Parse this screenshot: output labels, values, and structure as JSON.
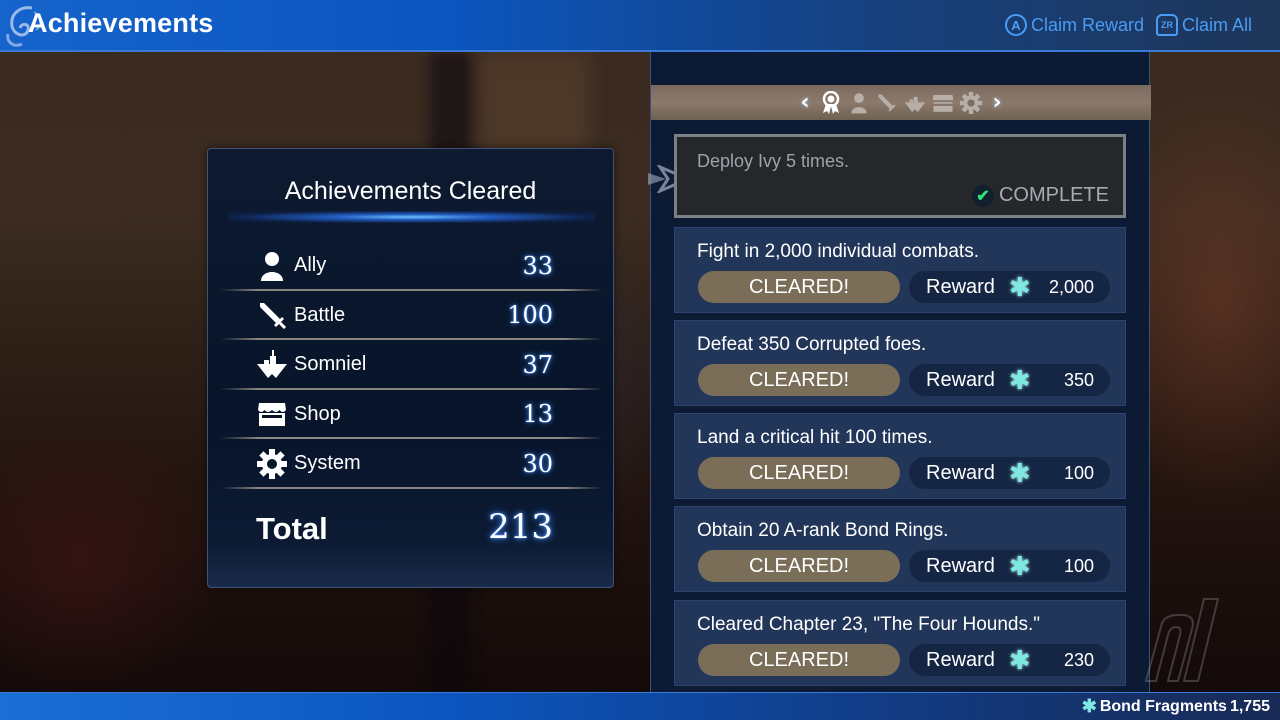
{
  "header": {
    "title": "Achievements",
    "actions": [
      {
        "button": "A",
        "label": "Claim Reward"
      },
      {
        "button": "ZR",
        "label": "Claim All"
      }
    ]
  },
  "summary": {
    "title": "Achievements Cleared",
    "rows": [
      {
        "icon": "person-icon",
        "label": "Ally",
        "value": "33"
      },
      {
        "icon": "sword-icon",
        "label": "Battle",
        "value": "100"
      },
      {
        "icon": "floating-island-icon",
        "label": "Somniel",
        "value": "37"
      },
      {
        "icon": "shop-icon",
        "label": "Shop",
        "value": "13"
      },
      {
        "icon": "gear-icon",
        "label": "System",
        "value": "30"
      }
    ],
    "total_label": "Total",
    "total_value": "213"
  },
  "tabs": {
    "prev": "‹",
    "next": "›",
    "items": [
      {
        "name": "medal",
        "active": true
      },
      {
        "name": "ally",
        "active": false
      },
      {
        "name": "battle",
        "active": false
      },
      {
        "name": "somniel",
        "active": false
      },
      {
        "name": "shop",
        "active": false
      },
      {
        "name": "system",
        "active": false
      }
    ]
  },
  "selected": {
    "description": "Deploy Ivy 5 times.",
    "status": "COMPLETE"
  },
  "achievements": [
    {
      "description": "Fight in 2,000 individual combats.",
      "status": "CLEARED!",
      "reward_label": "Reward",
      "reward": "2,000"
    },
    {
      "description": "Defeat 350 Corrupted foes.",
      "status": "CLEARED!",
      "reward_label": "Reward",
      "reward": "350"
    },
    {
      "description": "Land a critical hit 100 times.",
      "status": "CLEARED!",
      "reward_label": "Reward",
      "reward": "100"
    },
    {
      "description": "Obtain 20 A-rank Bond Rings.",
      "status": "CLEARED!",
      "reward_label": "Reward",
      "reward": "100"
    },
    {
      "description": "Cleared Chapter 23, \"The Four Hounds.\"",
      "status": "CLEARED!",
      "reward_label": "Reward",
      "reward": "230"
    }
  ],
  "footer": {
    "currency_label": "Bond Fragments",
    "currency_value": "1,755"
  },
  "colors": {
    "accent_blue": "#4a9cf5",
    "cleared_pill": "#7a6e59",
    "bond_fragment": "#7fe8e0",
    "complete_check": "#35e07a"
  }
}
